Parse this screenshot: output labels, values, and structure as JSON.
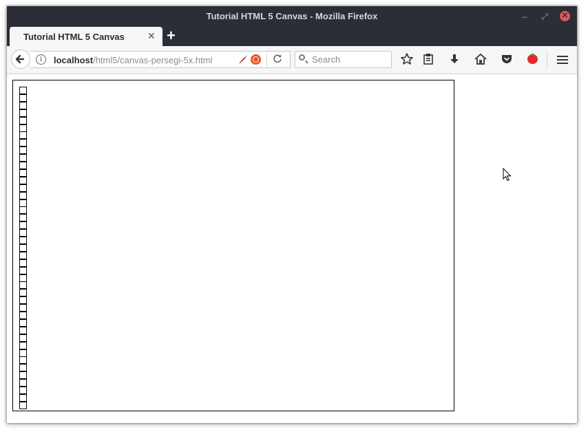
{
  "window": {
    "title": "Tutorial HTML 5 Canvas - Mozilla Firefox",
    "controls": {
      "minimize": "–",
      "maximize": "⤢",
      "close": "✕"
    }
  },
  "tabs": [
    {
      "label": "Tutorial HTML 5 Canvas",
      "close": "✕",
      "active": true
    }
  ],
  "new_tab": "+",
  "navbar": {
    "url_host": "localhost",
    "url_path": "/html5/canvas-persegi-5x.html",
    "search_placeholder": "Search",
    "icons": [
      "back-icon",
      "info-icon",
      "feather-extension-icon",
      "ubuntu-extension-icon",
      "reload-icon",
      "search-icon",
      "bookmark-star-icon",
      "clipboard-icon",
      "download-icon",
      "home-icon",
      "pocket-icon",
      "tomato-extension-icon",
      "menu-icon"
    ]
  },
  "canvas": {
    "description_shape": "square",
    "square_count": 43,
    "stroke_color": "#000000"
  },
  "colors": {
    "titlebar": "#2b2e37",
    "toolbar": "#f5f6f7",
    "close_button": "#e05560"
  }
}
